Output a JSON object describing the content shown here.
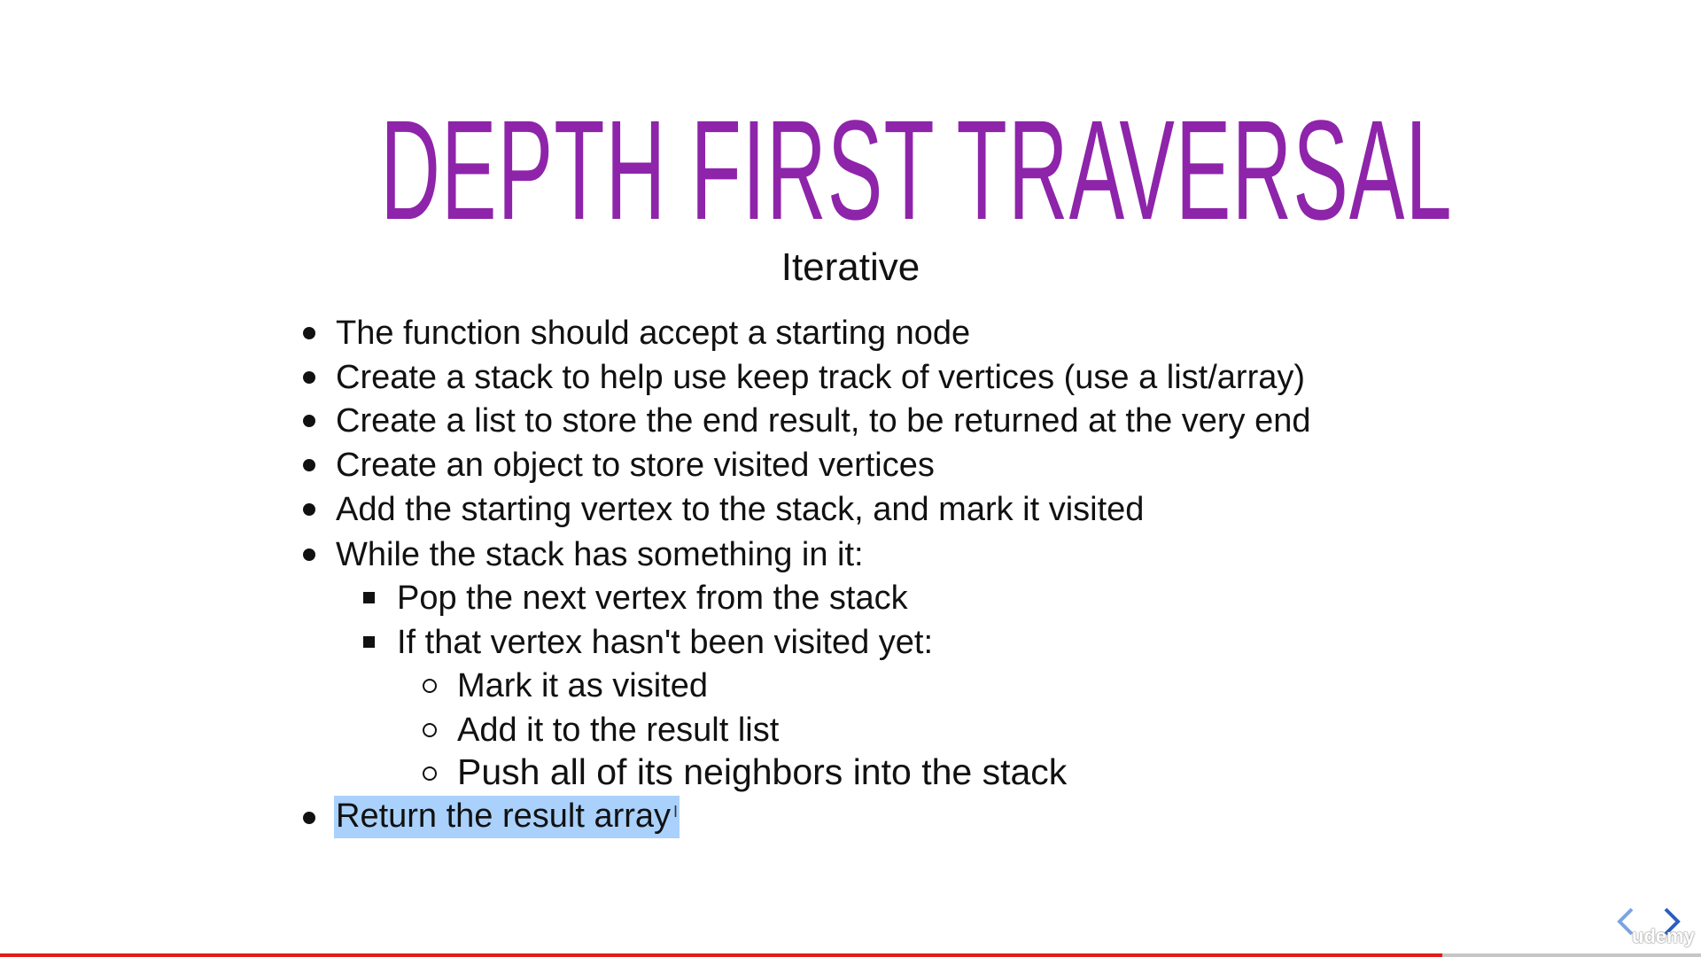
{
  "slide": {
    "title": "DEPTH FIRST TRAVERSAL",
    "subtitle": "Iterative",
    "bullets": [
      {
        "level": 1,
        "text": "The function should accept a starting node"
      },
      {
        "level": 1,
        "text": "Create a stack to help use keep track of vertices (use a list/array)"
      },
      {
        "level": 1,
        "text": "Create a list to store the end result, to be returned at the very end"
      },
      {
        "level": 1,
        "text": "Create an object to store visited vertices"
      },
      {
        "level": 1,
        "text": "Add the starting vertex to the stack, and mark it visited"
      },
      {
        "level": 1,
        "text": "While the stack has something in it:"
      },
      {
        "level": 2,
        "text": "Pop the next vertex from the stack"
      },
      {
        "level": 2,
        "text": "If that vertex hasn't been visited yet:"
      },
      {
        "level": 3,
        "text": "Mark it as visited"
      },
      {
        "level": 3,
        "text": "Add it to the result list"
      },
      {
        "level": 3,
        "text": "Push all of its neighbors into the stack"
      },
      {
        "level": 1,
        "text": "Return the result array",
        "highlighted": true
      }
    ]
  },
  "player": {
    "progress_percent": 84.8,
    "logo": "udemy",
    "accent": "#e31b1b",
    "title_color": "#8e24aa"
  }
}
